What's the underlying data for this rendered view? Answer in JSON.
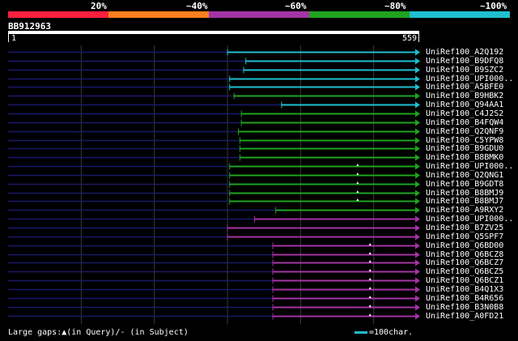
{
  "identity_legend": {
    "labels": [
      "20%",
      "~40%",
      "~60%",
      "~80%",
      "~100%"
    ],
    "colors": [
      "#ff1f3f",
      "#ff7f1f",
      "#a434a4",
      "#1fa31f",
      "#1fbfcf"
    ]
  },
  "query": {
    "id": "BB912963",
    "start": "1",
    "end": "559",
    "length": 559
  },
  "grid_positions": [
    100,
    200,
    300,
    400,
    500
  ],
  "hits": [
    {
      "label": "UniRef100_A2Q192",
      "color": "#1fbfcf",
      "start": 300,
      "gaps": []
    },
    {
      "label": "UniRef100_B9DFQ8",
      "color": "#1fbfcf",
      "start": 325,
      "gaps": []
    },
    {
      "label": "UniRef100_B9SZC2",
      "color": "#1fbfcf",
      "start": 322,
      "gaps": []
    },
    {
      "label": "UniRef100_UPI000..",
      "color": "#1fbfcf",
      "start": 303,
      "gaps": []
    },
    {
      "label": "UniRef100_A5BFE0",
      "color": "#1fbfcf",
      "start": 303,
      "gaps": []
    },
    {
      "label": "UniRef100_B9HBK2",
      "color": "#1fa31f",
      "start": 309,
      "gaps": []
    },
    {
      "label": "UniRef100_Q94AA1",
      "color": "#1fbfcf",
      "start": 374,
      "gaps": []
    },
    {
      "label": "UniRef100_C4J2S2",
      "color": "#1fa31f",
      "start": 319,
      "gaps": []
    },
    {
      "label": "UniRef100_B4FQW4",
      "color": "#1fa31f",
      "start": 319,
      "gaps": []
    },
    {
      "label": "UniRef100_Q2QNF9",
      "color": "#1fa31f",
      "start": 315,
      "gaps": []
    },
    {
      "label": "UniRef100_C5YPW8",
      "color": "#1fa31f",
      "start": 317,
      "gaps": []
    },
    {
      "label": "UniRef100_B9GDU0",
      "color": "#1fa31f",
      "start": 317,
      "gaps": []
    },
    {
      "label": "UniRef100_B8BMK0",
      "color": "#1fa31f",
      "start": 317,
      "gaps": []
    },
    {
      "label": "UniRef100_UPI000..",
      "color": "#1fa31f",
      "start": 303,
      "gaps": [
        478
      ]
    },
    {
      "label": "UniRef100_Q2QNG1",
      "color": "#1fa31f",
      "start": 303,
      "gaps": [
        478
      ]
    },
    {
      "label": "UniRef100_B9GDT8",
      "color": "#1fa31f",
      "start": 303,
      "gaps": [
        478
      ]
    },
    {
      "label": "UniRef100_B8BMJ9",
      "color": "#1fa31f",
      "start": 303,
      "gaps": [
        478
      ]
    },
    {
      "label": "UniRef100_B8BMJ7",
      "color": "#1fa31f",
      "start": 303,
      "gaps": [
        478
      ]
    },
    {
      "label": "UniRef100_A9RXY2",
      "color": "#1fa31f",
      "start": 366,
      "gaps": []
    },
    {
      "label": "UniRef100_UPI000..",
      "color": "#a434a4",
      "start": 337,
      "gaps": []
    },
    {
      "label": "UniRef100_B7ZV25",
      "color": "#a434a4",
      "start": 300,
      "gaps": []
    },
    {
      "label": "UniRef100_Q5SPF7",
      "color": "#a434a4",
      "start": 300,
      "gaps": []
    },
    {
      "label": "UniRef100_Q6BD00",
      "color": "#a434a4",
      "start": 362,
      "gaps": [
        495
      ]
    },
    {
      "label": "UniRef100_Q6BCZ8",
      "color": "#a434a4",
      "start": 362,
      "gaps": [
        495
      ]
    },
    {
      "label": "UniRef100_Q6BCZ7",
      "color": "#a434a4",
      "start": 362,
      "gaps": [
        495
      ]
    },
    {
      "label": "UniRef100_Q6BCZ5",
      "color": "#a434a4",
      "start": 362,
      "gaps": [
        495
      ]
    },
    {
      "label": "UniRef100_Q6BCZ1",
      "color": "#a434a4",
      "start": 362,
      "gaps": [
        495
      ]
    },
    {
      "label": "UniRef100_B4Q1X3",
      "color": "#a434a4",
      "start": 362,
      "gaps": [
        495
      ]
    },
    {
      "label": "UniRef100_B4R656",
      "color": "#a434a4",
      "start": 362,
      "gaps": [
        495
      ]
    },
    {
      "label": "UniRef100_B3N0B8",
      "color": "#a434a4",
      "start": 362,
      "gaps": [
        495
      ]
    },
    {
      "label": "UniRef100_A0FD21",
      "color": "#a434a4",
      "start": 362,
      "gaps": [
        495
      ]
    }
  ],
  "footer": {
    "gaps_note": "Large gaps:▲(in Query)/- (in Subject)",
    "scale_note": "=100char.",
    "scale_color": "#1fbfcf"
  }
}
